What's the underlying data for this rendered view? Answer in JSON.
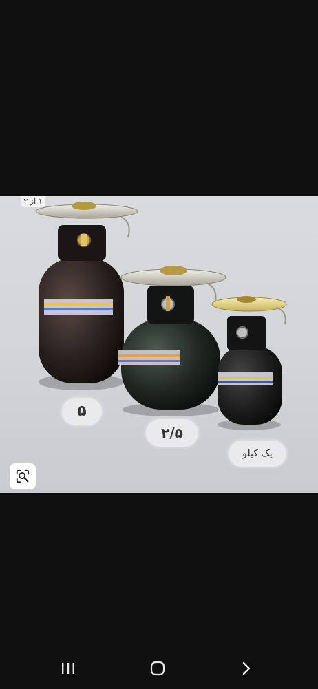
{
  "viewer": {
    "page_indicator": "۱ از ۲",
    "labels": {
      "size_large": "۵",
      "size_medium": "۲/۵",
      "size_small": "یک کیلو"
    }
  },
  "icons": {
    "lens": "google-lens-icon",
    "recents": "recent-apps-icon",
    "home": "home-icon",
    "back": "back-chevron-icon"
  },
  "colors": {
    "background": "#0f0f0f",
    "photo_bg": "#d4d6da",
    "cylinder": "#2a2220",
    "burner": "#c9c4b8"
  }
}
